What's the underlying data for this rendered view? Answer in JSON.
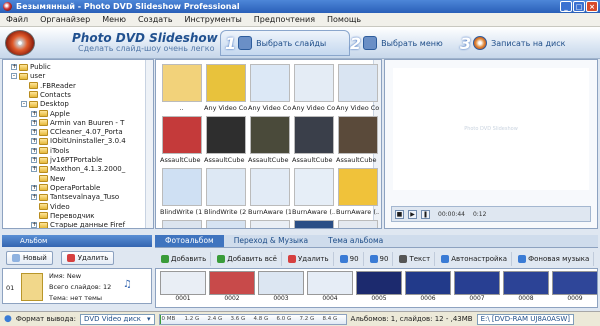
{
  "window": {
    "title": "Безымянный - Photo DVD Slideshow Professional"
  },
  "menu": [
    "Файл",
    "Органайзер",
    "Меню",
    "Создать",
    "Инструменты",
    "Предпочтения",
    "Помощь"
  ],
  "banner": {
    "title": "Photo DVD Slideshow",
    "subtitle": "Сделать слайд-шоу очень легко",
    "steps": [
      {
        "num": "1",
        "label": "Выбрать слайды"
      },
      {
        "num": "2",
        "label": "Выбрать меню"
      },
      {
        "num": "3",
        "label": "Записать на диск"
      }
    ]
  },
  "tree": {
    "items": [
      {
        "label": "Public",
        "level": 2,
        "exp": "+"
      },
      {
        "label": "user",
        "level": 2,
        "exp": "-"
      },
      {
        "label": ".FBReader",
        "level": 3,
        "exp": ""
      },
      {
        "label": "Contacts",
        "level": 3,
        "exp": ""
      },
      {
        "label": "Desktop",
        "level": 3,
        "exp": "-"
      },
      {
        "label": "Apple",
        "level": 4,
        "exp": "+"
      },
      {
        "label": "Armin van Buuren - T",
        "level": 4,
        "exp": "+"
      },
      {
        "label": "CCleaner_4.07_Porta",
        "level": 4,
        "exp": "+"
      },
      {
        "label": "IObitUninstaller_3.0.4",
        "level": 4,
        "exp": "+"
      },
      {
        "label": "iTools",
        "level": 4,
        "exp": "+"
      },
      {
        "label": "jv16PTPortable",
        "level": 4,
        "exp": "+"
      },
      {
        "label": "Maxthon_4.1.3.2000_",
        "level": 4,
        "exp": "+"
      },
      {
        "label": "New",
        "level": 4,
        "exp": ""
      },
      {
        "label": "OperaPortable",
        "level": 4,
        "exp": "+"
      },
      {
        "label": "Tantsevalnaya_Tuso",
        "level": 4,
        "exp": "+"
      },
      {
        "label": "Video",
        "level": 4,
        "exp": ""
      },
      {
        "label": "Переводчик",
        "level": 4,
        "exp": ""
      },
      {
        "label": "Старые данные Firef",
        "level": 4,
        "exp": "+"
      }
    ]
  },
  "browser": {
    "tiles": [
      {
        "cap": "..",
        "color": "#f2d27a"
      },
      {
        "cap": "Any Video Co...",
        "color": "#e8c23c"
      },
      {
        "cap": "Any Video Co...",
        "color": "#dce8f6"
      },
      {
        "cap": "Any Video Co...",
        "color": "#e4ecf5"
      },
      {
        "cap": "Any Video Co...",
        "color": "#d9e4f2"
      },
      {
        "cap": "AssaultCube ...",
        "color": "#c43a3a"
      },
      {
        "cap": "AssaultCube ...",
        "color": "#2e2e2e"
      },
      {
        "cap": "AssaultCube ...",
        "color": "#4a4a3a"
      },
      {
        "cap": "AssaultCube ...",
        "color": "#3a3f4a"
      },
      {
        "cap": "AssaultCube ...",
        "color": "#5a4a3a"
      },
      {
        "cap": "BlindWrite (1)...",
        "color": "#cfe0f3"
      },
      {
        "cap": "BlindWrite (2)...",
        "color": "#dde8f4"
      },
      {
        "cap": "BurnAware (1...",
        "color": "#e2ebf6"
      },
      {
        "cap": "BurnAware (...",
        "color": "#e6eef7"
      },
      {
        "cap": "BurnAware (...",
        "color": "#f0c23a"
      },
      {
        "cap": "",
        "color": "#dbe4ef"
      },
      {
        "cap": "",
        "color": "#d6e3f2"
      },
      {
        "cap": "",
        "color": "#e9eef5"
      },
      {
        "cap": "",
        "color": "#2b4f86"
      },
      {
        "cap": "",
        "color": "#e4e9f0"
      }
    ]
  },
  "preview": {
    "watermark": "Photo DVD Slideshow",
    "time1": "00:00:44",
    "time2": "0:12"
  },
  "album": {
    "header": "Альбом",
    "new_label": "Новый",
    "delete_label": "Удалить",
    "index": "01",
    "name": "Имя: New",
    "slides": "Всего слайдов: 12",
    "theme": "Тема: нет темы"
  },
  "tabs": [
    "Фотоальбом",
    "Переход & Музыка",
    "Тема альбома"
  ],
  "toolbar": [
    "Добавить",
    "Добавить всё",
    "Удалить",
    "90",
    "90",
    "Текст",
    "Автонастройка",
    "Фоновая музыка"
  ],
  "slides": [
    {
      "n": "0001",
      "color": "#e9eef5"
    },
    {
      "n": "0002",
      "color": "#c84a4a"
    },
    {
      "n": "0003",
      "color": "#dce6f2"
    },
    {
      "n": "0004",
      "color": "#e6edf6"
    },
    {
      "n": "0005",
      "color": "#1c2a6e"
    },
    {
      "n": "0006",
      "color": "#223a8a"
    },
    {
      "n": "0007",
      "color": "#283f92"
    },
    {
      "n": "0008",
      "color": "#2c4396"
    },
    {
      "n": "0009",
      "color": "#2f4699"
    }
  ],
  "status": {
    "format_label": "Формат вывода:",
    "format_value": "DVD Video диск",
    "capacity_ticks": [
      "0 MB",
      "1.2 G",
      "2.4 G",
      "3.6 G",
      "4.8 G",
      "6.0 G",
      "7.2 G",
      "8.4 G"
    ],
    "capacity_fill_fraction": 0.01,
    "info": "Альбомов: 1, слайдов: 12 - ,43MB",
    "drive": "E:\\ [DVD-RAM UJ8A0ASW]"
  }
}
